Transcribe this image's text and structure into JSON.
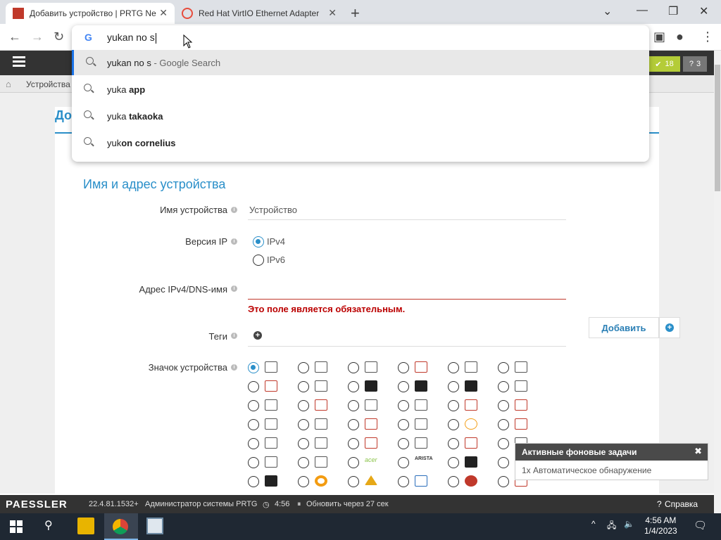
{
  "browser": {
    "tabs": [
      {
        "title": "Добавить устройство | PRTG Ne",
        "active": true
      },
      {
        "title": "Red Hat VirtIO Ethernet Adapter",
        "active": false
      }
    ],
    "omnibox_text": "yukan no s",
    "suggestions": [
      {
        "prefix": "yukan no s",
        "bold": "",
        "suffix": " - Google Search"
      },
      {
        "prefix": "yuka ",
        "bold": "app",
        "suffix": ""
      },
      {
        "prefix": "yuka ",
        "bold": "takaoka",
        "suffix": ""
      },
      {
        "prefix": "yuk",
        "bold": "on cornelius",
        "suffix": ""
      }
    ]
  },
  "app": {
    "badge_ok": "18",
    "badge_q": "3",
    "breadcrumb": "Устройства",
    "card_title": "До",
    "section_title": "Имя и адрес устройства",
    "fields": {
      "device_name_label": "Имя устройства",
      "device_name_value": "Устройство",
      "ip_version_label": "Версия IP",
      "ipv4": "IPv4",
      "ipv6": "IPv6",
      "address_label": "Адрес IPv4/DNS-имя",
      "address_error": "Это поле является обязательным.",
      "tags_label": "Теги",
      "add_button": "Добавить",
      "icon_label": "Значок устройства"
    },
    "notification": {
      "title": "Активные фоновые задачи",
      "body": "1x Автоматическое обнаружение"
    },
    "statusbar": {
      "logo": "PAESSLER",
      "version": "22.4.81.1532+",
      "user": "Администратор системы PRTG",
      "time": "4:56",
      "refresh": "Обновить через 27 сек",
      "help": "Справка"
    }
  },
  "taskbar": {
    "time": "4:56 AM",
    "date": "1/4/2023"
  }
}
